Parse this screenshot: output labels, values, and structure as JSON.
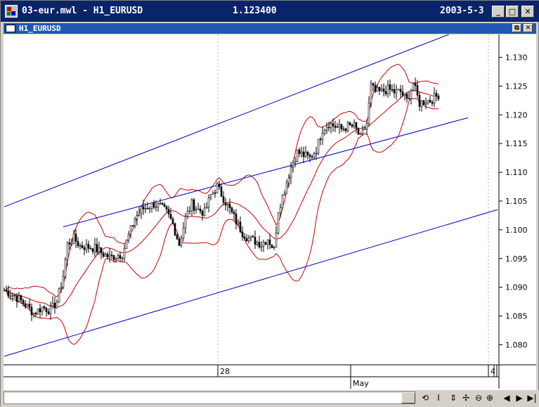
{
  "window": {
    "title": "03-eur.mwl - H1_EURUSD",
    "price": "1.123400",
    "date": "2003-5-3",
    "minimize": "_",
    "maximize": "□",
    "close": "✕"
  },
  "subwindow": {
    "title": "H1_EURUSD",
    "restore": "⧉",
    "close": "✕"
  },
  "colors": {
    "title_bg": "#0a246a",
    "sub_bg": "#2158b4",
    "candles": "#000000",
    "bollinger": "#cc0000",
    "channel": "#0000cc",
    "grid": "#b0b0b0"
  },
  "toolbar_icons": [
    "refresh-icon",
    "cursor-icon",
    "vertical-move-icon",
    "pan-icon",
    "zoom-out-icon",
    "zoom-in-icon",
    "scroll-left-icon",
    "scroll-right-icon",
    "scroll-end-icon"
  ],
  "toolbar_glyphs": [
    "⟲",
    "I",
    "⇕",
    "✢",
    "⊖",
    "⊕",
    "◀",
    "▶",
    "▶|"
  ],
  "chart_data": {
    "type": "candlestick",
    "symbol": "H1_EURUSD",
    "yaxis": {
      "ticks": [
        "1.080",
        "1.085",
        "1.090",
        "1.095",
        "1.100",
        "1.105",
        "1.110",
        "1.115",
        "1.120",
        "1.125",
        "1.130"
      ],
      "range": [
        1.0765,
        1.1335
      ]
    },
    "xaxis": {
      "day_labels": [
        "28",
        "4"
      ],
      "month_labels": [
        "May"
      ]
    },
    "close_path": [
      [
        0,
        1.0895
      ],
      [
        5,
        1.0885
      ],
      [
        10,
        1.087
      ],
      [
        14,
        1.0855
      ],
      [
        18,
        1.0865
      ],
      [
        22,
        1.086
      ],
      [
        25,
        1.0875
      ],
      [
        28,
        1.092
      ],
      [
        30,
        1.0975
      ],
      [
        33,
        1.0985
      ],
      [
        36,
        1.0972
      ],
      [
        40,
        1.097
      ],
      [
        43,
        1.0968
      ],
      [
        46,
        1.096
      ],
      [
        50,
        1.0952
      ],
      [
        53,
        1.0955
      ],
      [
        56,
        1.0958
      ],
      [
        59,
        1.099
      ],
      [
        62,
        1.102
      ],
      [
        65,
        1.1035
      ],
      [
        68,
        1.104
      ],
      [
        71,
        1.1045
      ],
      [
        74,
        1.104
      ],
      [
        77,
        1.103
      ],
      [
        80,
        1.101
      ],
      [
        83,
        1.0975
      ],
      [
        86,
        1.102
      ],
      [
        89,
        1.1045
      ],
      [
        92,
        1.1035
      ],
      [
        95,
        1.103
      ],
      [
        98,
        1.106
      ],
      [
        101,
        1.1075
      ],
      [
        104,
        1.1055
      ],
      [
        107,
        1.1035
      ],
      [
        110,
        1.1015
      ],
      [
        113,
        1.0995
      ],
      [
        116,
        1.0985
      ],
      [
        119,
        1.098
      ],
      [
        122,
        1.0975
      ],
      [
        125,
        1.0985
      ],
      [
        128,
        1.0965
      ],
      [
        130,
        1.1035
      ],
      [
        133,
        1.107
      ],
      [
        136,
        1.111
      ],
      [
        139,
        1.1135
      ],
      [
        142,
        1.113
      ],
      [
        145,
        1.1125
      ],
      [
        148,
        1.114
      ],
      [
        151,
        1.1175
      ],
      [
        154,
        1.1185
      ],
      [
        157,
        1.118
      ],
      [
        160,
        1.1175
      ],
      [
        163,
        1.118
      ],
      [
        166,
        1.118
      ],
      [
        169,
        1.116
      ],
      [
        172,
        1.1185
      ],
      [
        174,
        1.125
      ],
      [
        176,
        1.124
      ],
      [
        179,
        1.124
      ],
      [
        182,
        1.1245
      ],
      [
        185,
        1.124
      ],
      [
        188,
        1.124
      ],
      [
        191,
        1.1225
      ],
      [
        194,
        1.1255
      ],
      [
        197,
        1.122
      ],
      [
        200,
        1.1225
      ],
      [
        202,
        1.1225
      ],
      [
        204,
        1.123
      ],
      [
        206,
        1.1235
      ]
    ],
    "channel_lines": [
      {
        "name": "upper",
        "from": [
          0,
          1.104
        ],
        "to": [
          211,
          1.134
        ]
      },
      {
        "name": "middle",
        "from": [
          28,
          1.1005
        ],
        "to": [
          220,
          1.1195
        ]
      },
      {
        "name": "lower",
        "from": [
          0,
          1.078
        ],
        "to": [
          234,
          1.1035
        ]
      }
    ],
    "bollinger_period": 20,
    "bollinger_k": 2,
    "num_bars": 207
  }
}
